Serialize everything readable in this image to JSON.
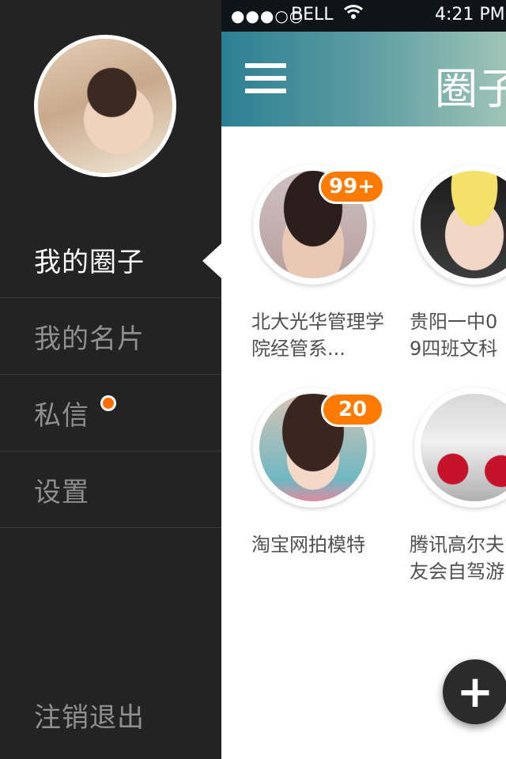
{
  "status_bar": {
    "signal": "●●●○○",
    "carrier": "BELL",
    "wifi_icon": "wifi-icon",
    "time": "4:21 PM"
  },
  "drawer": {
    "menu": [
      {
        "label": "我的圈子",
        "active": true
      },
      {
        "label": "我的名片",
        "active": false
      },
      {
        "label": "私信",
        "active": false,
        "has_unread_dot": true
      },
      {
        "label": "设置",
        "active": false
      }
    ],
    "logout_label": "注销退出"
  },
  "header": {
    "menu_icon": "hamburger-icon",
    "title": "圈子"
  },
  "circles": [
    {
      "name": "北大光华管理学院经管系...",
      "badge": "99+"
    },
    {
      "name": "贵阳一中09四班文科",
      "badge": ""
    },
    {
      "name": "淘宝网拍模特",
      "badge": "20"
    },
    {
      "name": "腾讯高尔夫友会自驾游",
      "badge": ""
    }
  ],
  "fab": {
    "icon": "plus-icon",
    "label": "+"
  },
  "colors": {
    "drawer_bg": "#232323",
    "badge": "#ff7a00",
    "unread_dot": "#ff6d00",
    "header_gradient_start": "#2b7f93",
    "header_gradient_end": "#9fc4b6"
  }
}
